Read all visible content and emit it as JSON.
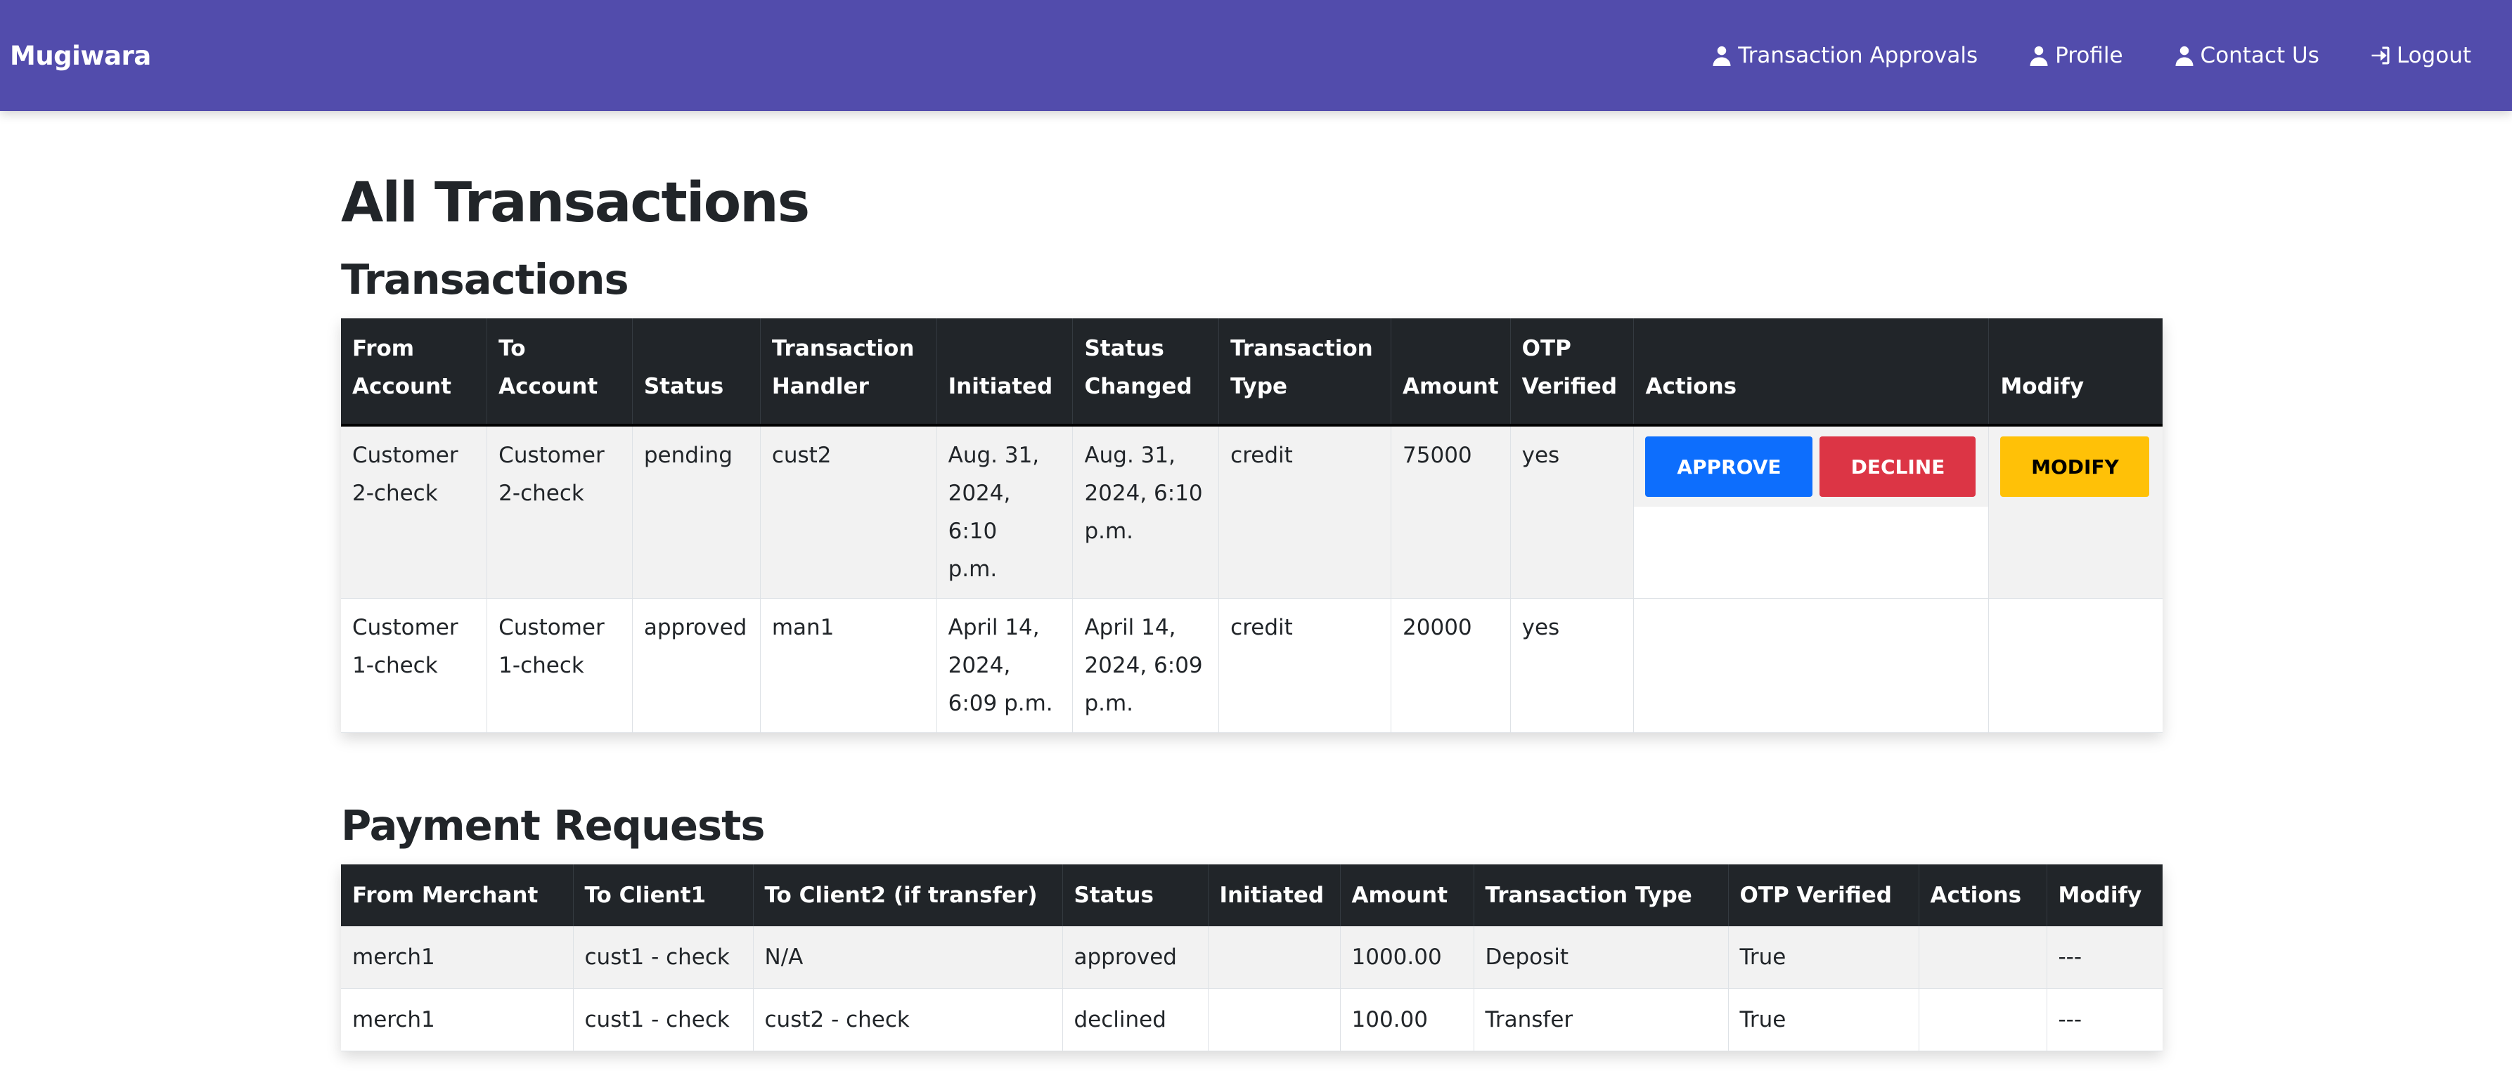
{
  "nav": {
    "brand": "Mugiwara",
    "links": [
      {
        "label": "Transaction Approvals",
        "icon": "user-icon"
      },
      {
        "label": "Profile",
        "icon": "user-icon"
      },
      {
        "label": "Contact Us",
        "icon": "user-icon"
      },
      {
        "label": "Logout",
        "icon": "logout-icon"
      }
    ]
  },
  "page": {
    "title": "All Transactions",
    "transactions_title": "Transactions",
    "payments_title": "Payment Requests"
  },
  "transactions": {
    "headers": {
      "from_account": [
        "From",
        "Account"
      ],
      "to_account": [
        "To",
        "Account"
      ],
      "status": "Status",
      "handler": [
        "Transaction",
        "Handler"
      ],
      "initiated": "Initiated",
      "status_changed": [
        "Status",
        "Changed"
      ],
      "type": [
        "Transaction",
        "Type"
      ],
      "amount": "Amount",
      "otp": [
        "OTP",
        "Verified"
      ],
      "actions": "Actions",
      "modify": "Modify"
    },
    "rows": [
      {
        "from_account": [
          "Customer",
          "2-check"
        ],
        "to_account": [
          "Customer",
          "2-check"
        ],
        "status": "pending",
        "handler": "cust2",
        "initiated": [
          "Aug. 31,",
          "2024, 6:10",
          "p.m."
        ],
        "status_changed": [
          "Aug. 31,",
          "2024, 6:10",
          "p.m."
        ],
        "type": "credit",
        "amount": "75000",
        "otp": "yes",
        "approve_label": "Approve",
        "decline_label": "Decline",
        "modify_label": "Modify"
      },
      {
        "from_account": [
          "Customer",
          "1-check"
        ],
        "to_account": [
          "Customer",
          "1-check"
        ],
        "status": "approved",
        "handler": "man1",
        "initiated": [
          "April 14,",
          "2024,",
          "6:09 p.m."
        ],
        "status_changed": [
          "April 14,",
          "2024, 6:09",
          "p.m."
        ],
        "type": "credit",
        "amount": "20000",
        "otp": "yes"
      }
    ]
  },
  "payments": {
    "headers": [
      "From Merchant",
      "To Client1",
      "To Client2 (if transfer)",
      "Status",
      "Initiated",
      "Amount",
      "Transaction Type",
      "OTP Verified",
      "Actions",
      "Modify"
    ],
    "rows": [
      [
        "merch1",
        "cust1 - check",
        "N/A",
        "approved",
        "",
        "1000.00",
        "Deposit",
        "True",
        "",
        "---"
      ],
      [
        "merch1",
        "cust1 - check",
        "cust2 - check",
        "declined",
        "",
        "100.00",
        "Transfer",
        "True",
        "",
        "---"
      ]
    ]
  },
  "colors": {
    "navbar": "#524cac",
    "table_header": "#212529",
    "approve": "#0d6efd",
    "decline": "#dc3545",
    "modify": "#ffc107"
  }
}
